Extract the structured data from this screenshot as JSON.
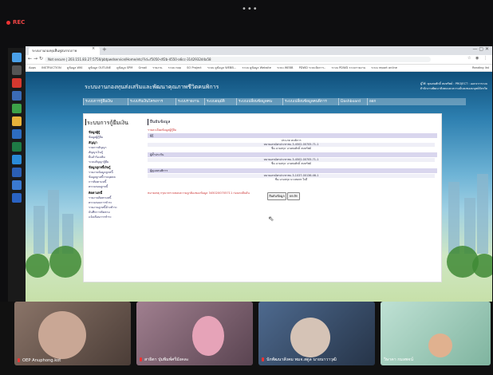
{
  "recording": {
    "label": "REC"
  },
  "window_dots": "•••",
  "browser": {
    "tab_title": "ระบบงานกองทุนฟื้นฟูสมรรถภาพ",
    "address": "Not secure | 203.151.83.27:5750/pbtpwdservice/Home/etc/?id=f5050-df2b-4550-a6cc-3142932d4a58",
    "bookmarks": [
      "Apps",
      "INSTRUCTION",
      "ดูข้อมูล WKI",
      "ดูข้อมูล OUTLINE",
      "ดูข้อมูล SPM",
      "Gmail",
      "รายงาน",
      "ระบบ nop",
      "SO Project",
      "ระบบ ดูข้อมูล WEBB...",
      "ระบบ ดูข้อมูล Website",
      "ระบบ WEBB",
      "PDWD ระบบจัดการ..",
      "ระบบ PDWD ระบบรายงาน",
      "ระบบ report online"
    ],
    "bookmarks_right": "Reading list"
  },
  "site": {
    "title": "ระบบงานกองทุนส่งเสริมและพัฒนาคุณภาพชีวิตคนพิการ",
    "user_info_1": "ผู้ใช้: คุณสมศักดิ์ สมทรัพย์ : PROJECT : ออกจากระบบ",
    "user_info_2": "สำนักงานพัฒนาสังคมและความมั่นคงของมนุษย์จังหวัด",
    "menu": [
      "ระบบการกู้ยืมเงิน",
      "ระบบรับเงินโครงการ",
      "ระบบรายงาน",
      "ระบบอนุมัติ",
      "ระบบเปลี่ยนข้อมูลคน",
      "ระบบเปลี่ยนข้อมูลคนพิการ",
      "Dashboard",
      "ออก"
    ]
  },
  "left_panel": {
    "title": "ระบบการกู้ยืมเงิน",
    "groups": [
      {
        "head": "ข้อมูลผู้กู้",
        "items": [
          "ข้อมูลผู้กู้ยืม"
        ]
      },
      {
        "head": "สัญญา",
        "items": [
          "รายการสัญญา",
          "สัญญาเงินกู้",
          "ยื่นคำร้องเพิ่ม",
          "ระบบสัญญากู้ยืม"
        ]
      },
      {
        "head": "ข้อมูลลูกหนี้เงินกู้",
        "items": [
          "รายงานข้อมูลลูกหนี้",
          "ข้อมูลลูกหนี้รายบุคคล",
          "การติดตามหนี้",
          "ตรวจสอบลูกหนี้"
        ]
      },
      {
        "head": "ติดตามหนี้",
        "items": [
          "รายงานติดตามหนี้",
          "ตรวจสอบการชำระ",
          "รายงานลูกหนี้ค้างชำระ",
          "บันทึกการติดตาม",
          "แจ้งเตือนการชำระ"
        ]
      }
    ]
  },
  "main": {
    "title": "ยืนยันข้อมูล",
    "subtitle": "รายละเอียดข้อมูลผู้กู้ยืม",
    "sections": [
      {
        "label": "ผู้กู้",
        "rows": [
          "ประเภท คนพิการ",
          "หมายเลขบัตรประชาชน 3-4502-00705-71-1",
          "ชื่อ-นามสกุล นายสมศักดิ์ สมทรัพย์"
        ]
      },
      {
        "label": "ผู้ค้ำประกัน",
        "rows": [
          "หมายเลขบัตรประชาชน 3-4502-00705-71-1",
          "ชื่อ-นามสกุล นายสมศักดิ์ สมทรัพย์"
        ]
      },
      {
        "label": "ผู้ดูแลคนพิการ",
        "rows": [
          "หมายเลขบัตรประชาชน 3-1037-00136-46-1",
          "ชื่อ-นามสกุล นางสมพร ใจดี"
        ]
      }
    ],
    "note": "หมายเหตุ กรุณาตรวจสอบความถูกต้องของข้อมูล 3450200705711 ก่อนกดยืนยัน",
    "buttons": {
      "confirm": "ยืนยันข้อมูล",
      "cancel": "ยกเลิก"
    }
  },
  "participants": [
    {
      "name": "OEP Anuphong.kot",
      "color": "#6a5a52"
    },
    {
      "name": "สาธิตา ปุ่มพิมพ์ศรีมังคละ",
      "color": "#7e5d6b"
    },
    {
      "name": "นักพัฒนาสังคม พมจ.สตูล นายนาวาวุฒิ",
      "color": "#3b4a6a"
    },
    {
      "name": "วิษาคา กมลพจน์",
      "color": "#8fb7a4"
    }
  ]
}
